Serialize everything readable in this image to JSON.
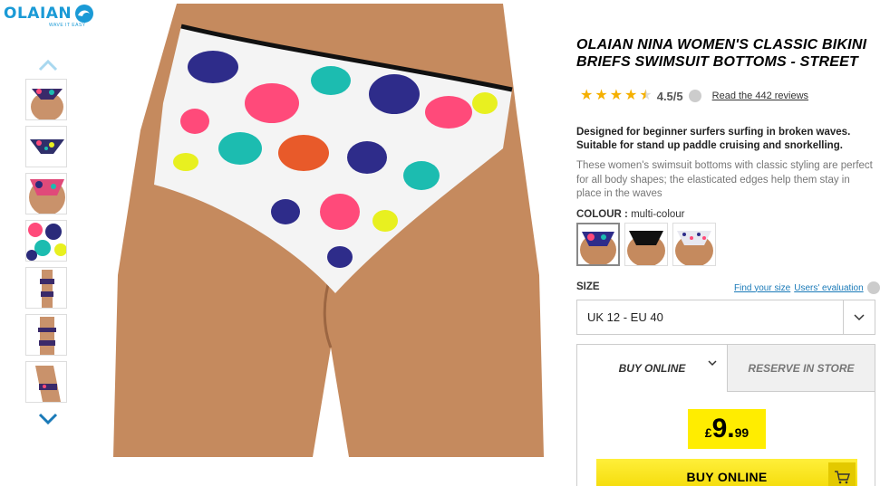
{
  "brand": {
    "name": "OLAIAN",
    "tagline": "WAVE IT EASY",
    "color": "#1a9ad6"
  },
  "product": {
    "title": "OLAIAN NINA WOMEN'S CLASSIC BIKINI BRIEFS SWIMSUIT BOTTOMS - STREET",
    "rating": "4.5/5",
    "rating_value": 4.5,
    "reviews_link": "Read the 442 reviews",
    "description_bold": "Designed for beginner surfers surfing in broken waves. Suitable for stand up paddle cruising and snorkelling.",
    "description": "These women's swimsuit bottoms with classic styling are perfect for all body shapes; the elasticated edges help them stay in place in the waves"
  },
  "colour": {
    "label": "COLOUR :",
    "value": "multi-colour",
    "swatches": [
      "multi-colour",
      "black",
      "print"
    ]
  },
  "size": {
    "label": "SIZE",
    "find_link": "Find your size",
    "eval_link": "Users' evaluation",
    "selected": "UK 12 - EU 40"
  },
  "purchase": {
    "tab_buy": "BUY ONLINE",
    "tab_reserve": "RESERVE IN STORE",
    "price_currency": "£",
    "price_int": "9.",
    "price_dec": "99",
    "buy_button": "BUY ONLINE"
  },
  "colors": {
    "accent_yellow": "#ffed00",
    "link_blue": "#1a7ab8",
    "star": "#f5b000"
  }
}
